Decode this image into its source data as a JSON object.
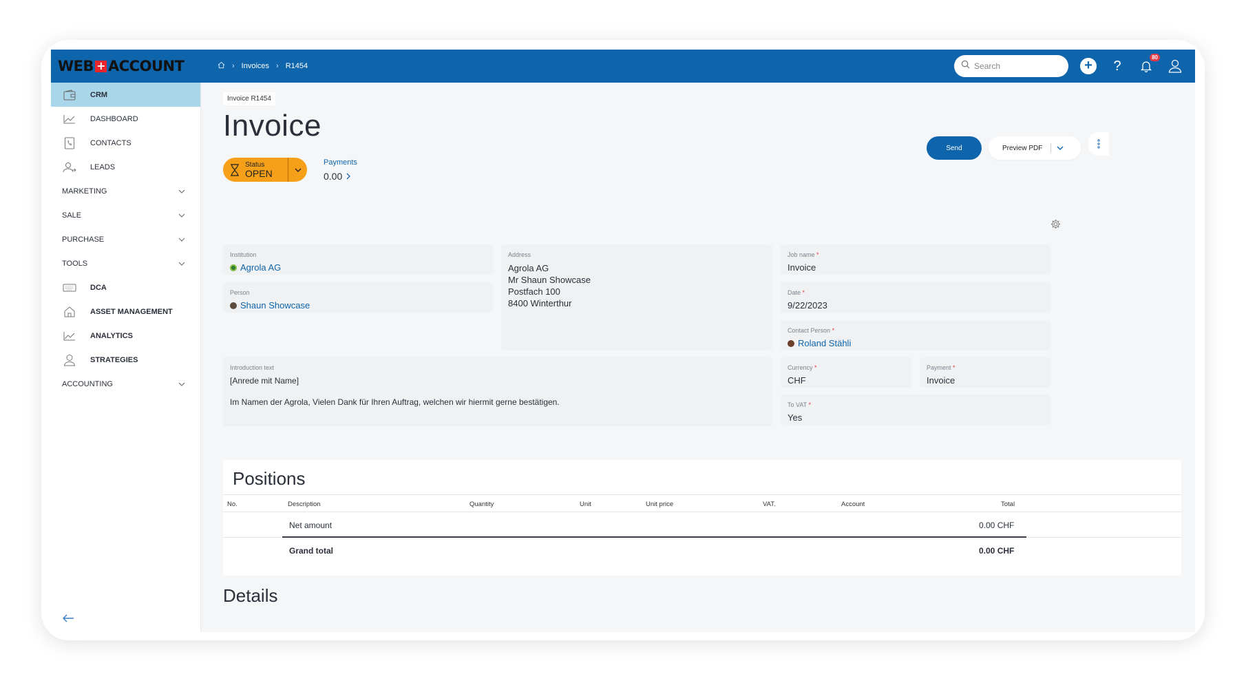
{
  "brand": {
    "part1": "WEB",
    "part2": "ACCOUNT"
  },
  "breadcrumb": {
    "items": [
      "Invoices",
      "R1454"
    ]
  },
  "search": {
    "placeholder": "Search"
  },
  "notifications": {
    "count": "80"
  },
  "sidebar": {
    "items": [
      {
        "label": "CRM",
        "icon": "wallet-icon"
      },
      {
        "label": "DASHBOARD",
        "icon": "chart-line-icon"
      },
      {
        "label": "CONTACTS",
        "icon": "phone-book-icon"
      },
      {
        "label": "LEADS",
        "icon": "user-arrow-icon"
      },
      {
        "label": "MARKETING"
      },
      {
        "label": "SALE"
      },
      {
        "label": "PURCHASE"
      },
      {
        "label": "TOOLS"
      },
      {
        "label": "DCA",
        "icon": "keyboard-icon"
      },
      {
        "label": "ASSET MANAGEMENT",
        "icon": "house-icon"
      },
      {
        "label": "ANALYTICS",
        "icon": "chart-line-icon"
      },
      {
        "label": "STRATEGIES",
        "icon": "person-icon"
      },
      {
        "label": "ACCOUNTING"
      }
    ]
  },
  "page": {
    "chip": "Invoice R1454",
    "title": "Invoice",
    "status": {
      "label": "Status",
      "value": "OPEN",
      "color": "#f6a01a"
    },
    "payments": {
      "label": "Payments",
      "value": "0.00"
    },
    "send_label": "Send",
    "preview_label": "Preview PDF"
  },
  "form": {
    "institution": {
      "label": "Institution",
      "value": "Agrola AG"
    },
    "person": {
      "label": "Person",
      "value": "Shaun Showcase"
    },
    "address": {
      "label": "Address",
      "lines": [
        "Agrola AG",
        "Mr Shaun Showcase",
        "Postfach 100",
        "8400 Winterthur"
      ]
    },
    "job_name": {
      "label": "Job name",
      "value": "Invoice"
    },
    "date": {
      "label": "Date",
      "value": "9/22/2023"
    },
    "contact_person": {
      "label": "Contact Person",
      "value": "Roland Stähli"
    },
    "intro": {
      "label": "Introduction text",
      "line1": "[Anrede mit Name]",
      "line2": "Im Namen der Agrola, Vielen Dank für Ihren Auftrag, welchen wir hiermit gerne bestätigen."
    },
    "currency": {
      "label": "Currency",
      "value": "CHF"
    },
    "payment": {
      "label": "Payment",
      "value": "Invoice"
    },
    "to_vat": {
      "label": "To VAT",
      "value": "Yes"
    },
    "required_mark": "*"
  },
  "positions": {
    "title": "Positions",
    "columns": [
      "No.",
      "Description",
      "Quantity",
      "Unit",
      "Unit price",
      "VAT.",
      "Account",
      "Total"
    ],
    "net_label": "Net amount",
    "net_value": "0.00 CHF",
    "grand_label": "Grand total",
    "grand_value": "0.00 CHF"
  },
  "details_title": "Details",
  "colors": {
    "primary": "#0e65ac",
    "active_nav": "#a9d6e8",
    "status": "#f6a01a",
    "required": "#e63946"
  }
}
